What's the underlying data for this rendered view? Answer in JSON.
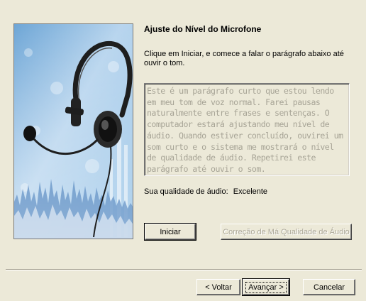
{
  "wizard": {
    "title": "Ajuste do Nível do Microfone",
    "instructions": "Clique em Iniciar, e comece a falar o parágrafo abaixo até ouvir o tom.",
    "paragraph": "Este é um parágrafo curto que estou lendo em meu tom de voz normal. Farei pausas naturalmente entre frases e sentenças. O computador estará ajustando meu nível de áudio. Quando estiver concluído, ouvirei um som curto e o sistema me mostrará o nível de qualidade de áudio. Repetirei este parágrafo até ouvir o som.",
    "quality_label": "Sua qualidade de áudio:",
    "quality_value": "Excelente"
  },
  "buttons": {
    "start": {
      "label": "Iniciar",
      "enabled": true
    },
    "fix_quality": {
      "label": "Correção de Má Qualidade de Áudio",
      "enabled": false
    },
    "back": {
      "label": "< Voltar",
      "enabled": true
    },
    "next": {
      "label": "Avançar >",
      "enabled": true,
      "default": true
    },
    "cancel": {
      "label": "Cancelar",
      "enabled": true
    }
  },
  "art": {
    "icon": "headset-microphone-icon",
    "colors": {
      "sky": "#7fb2dc",
      "sky_light": "#cfe2f2",
      "wave": "#3d78b8",
      "headset": "#1e1e1e"
    }
  },
  "colors": {
    "dialog_bg": "#ece9d8",
    "disabled_text": "#a7a496"
  }
}
